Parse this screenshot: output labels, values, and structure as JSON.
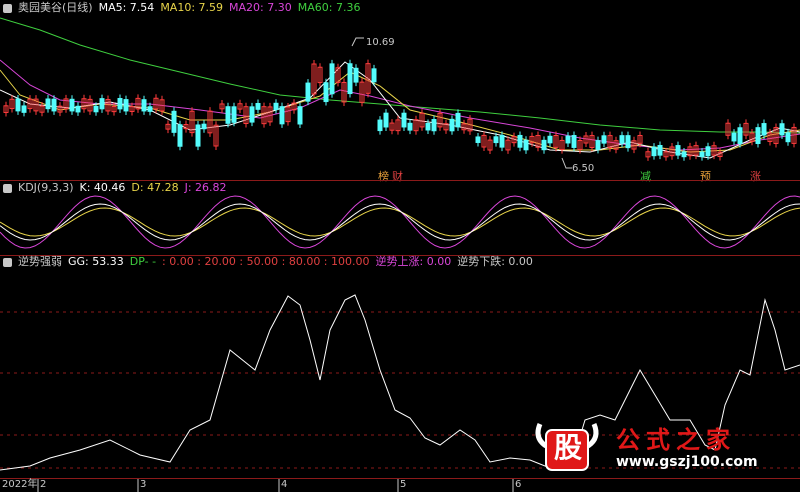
{
  "main": {
    "title": "奥园美谷(日线)",
    "ma": [
      {
        "label": "MA5: 7.54",
        "color": "#ffffff"
      },
      {
        "label": "MA10: 7.59",
        "color": "#e8d44a"
      },
      {
        "label": "MA20: 7.30",
        "color": "#d946d9"
      },
      {
        "label": "MA60: 7.36",
        "color": "#3fcf3f"
      }
    ],
    "high_label": "10.69",
    "low_label": "6.50",
    "markers": [
      {
        "text": "榜",
        "color": "#e8a03a"
      },
      {
        "text": "财",
        "color": "#e04040"
      },
      {
        "text": "减",
        "color": "#3fcf3f"
      },
      {
        "text": "预",
        "color": "#e8a03a"
      },
      {
        "text": "涨",
        "color": "#e04040"
      }
    ]
  },
  "kdj": {
    "title": "KDJ(9,3,3)",
    "k": "K: 40.46",
    "d": "D: 47.28",
    "j": "J: 26.82"
  },
  "ind": {
    "title": "逆势强弱",
    "gg": "GG: 53.33",
    "dp": "DP- -",
    "levels": ": 0.00 : 20.00 : 50.00 : 80.00 : 100.00",
    "up": "逆势上涨: 0.00",
    "down": "逆势下跌: 0.00"
  },
  "xaxis": {
    "year": "2022年",
    "months": [
      "2",
      "3",
      "4",
      "5",
      "6"
    ]
  },
  "watermark": {
    "big": "股",
    "title": "公式之家",
    "url": "www.gszj100.com"
  },
  "colors": {
    "up": "#ff3c3c",
    "down": "#54fcfc",
    "grid": "#8b1a1a"
  }
}
